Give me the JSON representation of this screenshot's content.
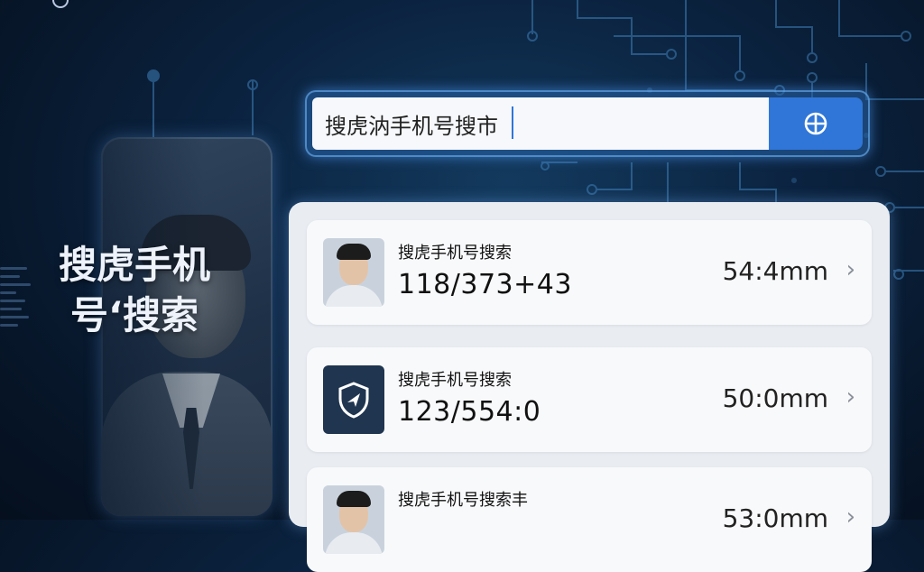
{
  "top_logo": {
    "text": ""
  },
  "hero": {
    "title": "搜虎手机号‘搜索"
  },
  "search": {
    "value": "搜虎汭手机号搜市",
    "button_icon": "crosshair-search-icon"
  },
  "results": [
    {
      "title": "搜虎手机号搜索",
      "value": "118/373+43",
      "time": "54:4mm",
      "icon": "person-avatar"
    },
    {
      "title": "搜虎手机号搜索",
      "value": "123/554:0",
      "time": "50:0mm",
      "icon": "shield-icon"
    },
    {
      "title": "搜虎手机号搜索丰",
      "value": "",
      "time": "53:0mm",
      "icon": "person-avatar"
    }
  ],
  "colors": {
    "accent": "#2f76d8",
    "background": "#0b2340",
    "panel": "#e9edf2",
    "shield_tile": "#1f3550"
  }
}
